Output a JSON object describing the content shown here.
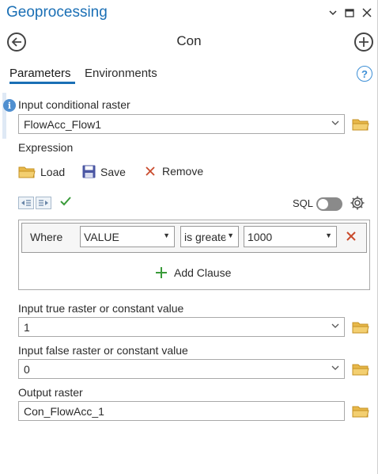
{
  "pane": {
    "title": "Geoprocessing"
  },
  "tool": {
    "title": "Con"
  },
  "tabs": {
    "parameters": "Parameters",
    "environments": "Environments"
  },
  "params": {
    "input_conditional_raster": {
      "label": "Input conditional raster",
      "value": "FlowAcc_Flow1"
    },
    "expression": {
      "label": "Expression"
    },
    "input_true": {
      "label": "Input true raster or constant value",
      "value": "1"
    },
    "input_false": {
      "label": "Input false raster or constant value",
      "value": "0"
    },
    "output_raster": {
      "label": "Output raster",
      "value": "Con_FlowAcc_1"
    }
  },
  "expression_actions": {
    "load": "Load",
    "save": "Save",
    "remove": "Remove"
  },
  "sql_toggle": {
    "label": "SQL",
    "on": false
  },
  "clause": {
    "where": "Where",
    "field": "VALUE",
    "operator": "is greate",
    "value": "1000"
  },
  "add_clause": "Add Clause",
  "icons": {
    "minimize": "chevron-down-icon",
    "maximize": "maximize-icon",
    "close": "close-icon",
    "back": "back-arrow-icon",
    "add": "plus-circle-icon",
    "help": "help-icon",
    "info": "info-icon",
    "folder": "folder-icon",
    "save": "floppy-disk-icon",
    "validate": "checkmark-icon",
    "settings": "gear-icon"
  },
  "colors": {
    "accent": "#1a6fb5",
    "folder": "#e8b84a",
    "remove": "#c94b2d",
    "add": "#3a9b3a"
  }
}
